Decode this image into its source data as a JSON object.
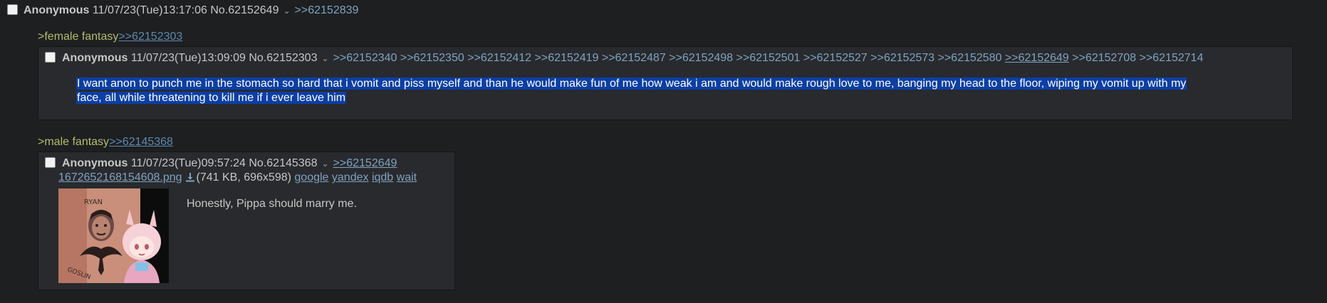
{
  "post_main": {
    "name": "Anonymous",
    "datetime": "11/07/23(Tue)13:17:06",
    "number": "No.62152649",
    "caret": "⌄",
    "backlink": ">>62152839"
  },
  "section1": {
    "greentext": ">female fantasy",
    "link": ">>62152303"
  },
  "quoted_post1": {
    "name": "Anonymous",
    "datetime": "11/07/23(Tue)13:09:09",
    "number": "No.62152303",
    "caret": "⌄",
    "backlinks": [
      ">>62152340",
      ">>62152350",
      ">>62152412",
      ">>62152419",
      ">>62152487",
      ">>62152498",
      ">>62152501",
      ">>62152527",
      ">>62152573",
      ">>62152580",
      ">>62152649",
      ">>62152708",
      ">>62152714"
    ],
    "body_line1": "I want anon to punch me in the stomach so hard that i vomit and piss myself and than he would make fun of me how weak i am and would make rough love to me, banging my head to the floor, wiping my vomit up with my",
    "body_line2": "face, all while threatening to kill me if i ever leave him"
  },
  "section2": {
    "greentext": ">male fantasy",
    "link": ">>62145368"
  },
  "quoted_post2": {
    "name": "Anonymous",
    "datetime": "11/07/23(Tue)09:57:24",
    "number": "No.62145368",
    "caret": "⌄",
    "backlink": ">>62152649",
    "file_name": "1672652168154608.png",
    "file_info": "(741 KB, 696x598)",
    "search_links": [
      "google",
      "yandex",
      "iqdb",
      "wait"
    ],
    "thumbnail_icon": "tattoo-and-anime-girl-thumbnail",
    "thumbnail_text_top": "RYAN",
    "thumbnail_text_bottom": "GOSLIN",
    "body": "Honestly, Pippa should marry me."
  },
  "colors": {
    "background": "#1d1f21",
    "post_bg": "#282a2e",
    "text": "#c5c8c6",
    "link": "#81a2be",
    "greentext": "#b5bd68",
    "selection": "#0b3fa6"
  }
}
